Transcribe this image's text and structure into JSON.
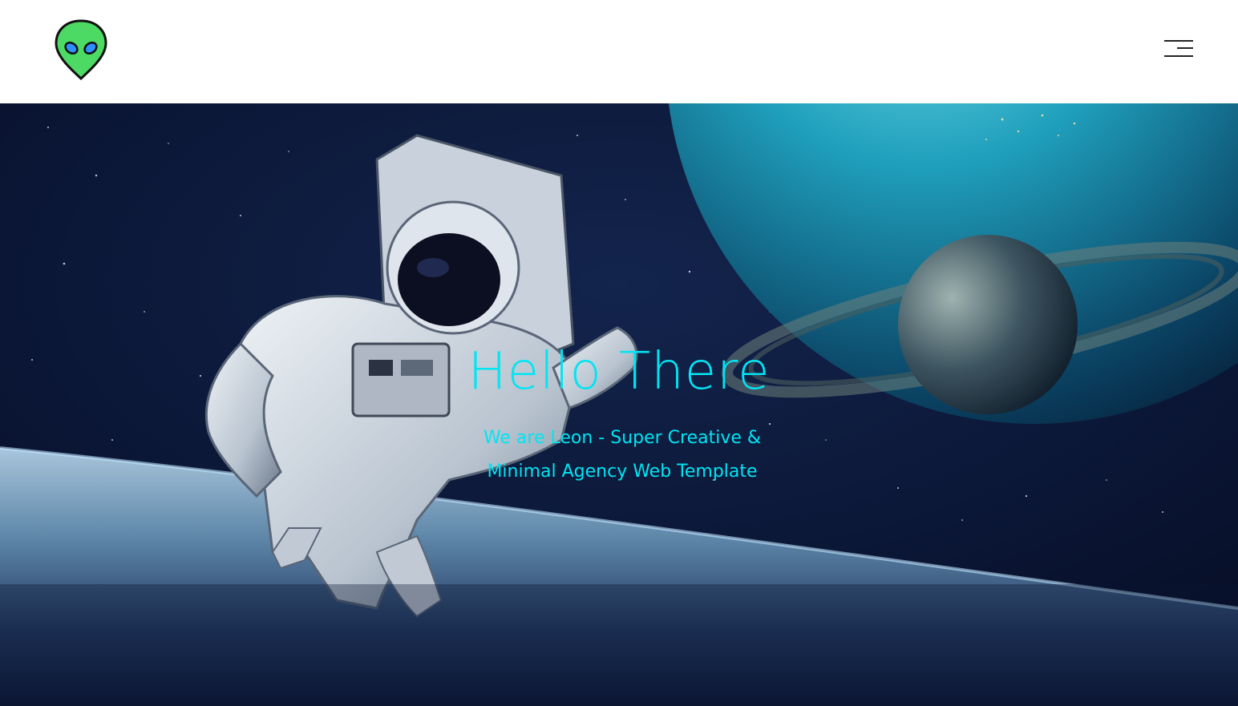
{
  "header": {
    "logo_icon": "alien-head-icon",
    "menu_icon": "hamburger-menu-icon"
  },
  "hero": {
    "title": "Hello There",
    "subtitle_line1": "We are Leon - Super Creative &",
    "subtitle_line2": "Minimal Agency Web Template",
    "background": "astronaut-in-space-image"
  },
  "colors": {
    "accent": "#00e5f2",
    "header_bg": "#ffffff",
    "logo_green": "#4cd964",
    "logo_eye": "#2f8fff"
  }
}
